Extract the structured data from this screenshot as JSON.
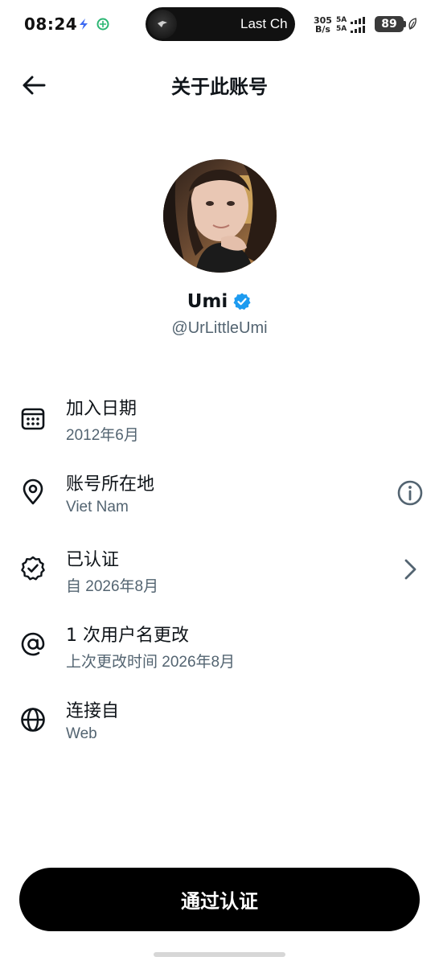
{
  "status_bar": {
    "time": "08:24",
    "media_text": "Last Ch",
    "net_speed_value": "305",
    "net_speed_unit": "B/s",
    "sim1": "5A",
    "sim2": "5A",
    "battery": "89"
  },
  "header": {
    "title": "关于此账号"
  },
  "profile": {
    "display_name": "Umi",
    "handle": "@UrLittleUmi",
    "verified_color": "#1d9bf0"
  },
  "info_items": [
    {
      "icon": "calendar-icon",
      "title": "加入日期",
      "subtitle": "2012年6月"
    },
    {
      "icon": "location-pin-icon",
      "title": "账号所在地",
      "subtitle": "Viet Nam",
      "trailing": "info-icon"
    },
    {
      "icon": "verified-badge-icon",
      "title": "已认证",
      "subtitle": "自 2026年8月",
      "trailing": "chevron-right-icon"
    },
    {
      "icon": "at-sign-icon",
      "title": "1 次用户名更改",
      "subtitle": "上次更改时间 2026年8月"
    },
    {
      "icon": "globe-icon",
      "title": "连接自",
      "subtitle": "Web"
    }
  ],
  "footer": {
    "button_label": "通过认证"
  },
  "colors": {
    "primary_text": "#0f1419",
    "secondary_text": "#536471",
    "button_bg": "#000000",
    "verified": "#1d9bf0"
  }
}
